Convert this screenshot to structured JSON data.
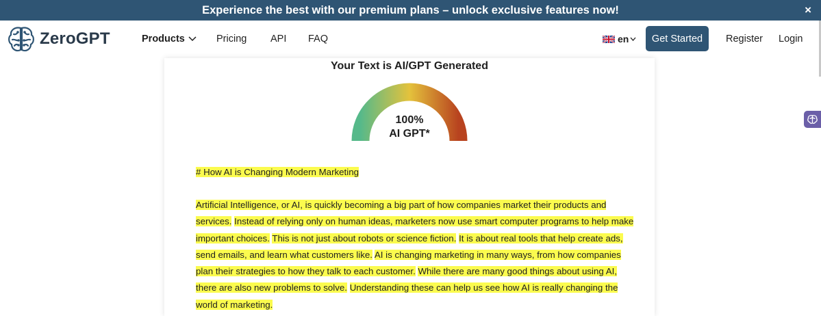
{
  "promo": {
    "text": "Experience the best with our premium plans – unlock exclusive features now!",
    "close": "×"
  },
  "nav": {
    "logo": "ZeroGPT",
    "products": "Products",
    "pricing": "Pricing",
    "api": "API",
    "faq": "FAQ",
    "language": "en",
    "get_started": "Get Started",
    "register": "Register",
    "login": "Login"
  },
  "result": {
    "title": "Your Text is AI/GPT Generated",
    "percent": "100%",
    "label": "AI GPT*",
    "gauge_level": 1.0
  },
  "analysis": {
    "heading": "# How AI is Changing Modern Marketing",
    "sentences": [
      "Artificial Intelligence, or AI, is quickly becoming a big part of how companies market their products and services.",
      "Instead of relying only on human ideas, marketers now use smart computer programs to help make important choices.",
      "This is not just about robots or science fiction.",
      "It is about real tools that help create ads, send emails, and learn what customers like.",
      "AI is changing marketing in many ways, from how companies plan their strategies to how they talk to each customer.",
      "While there are many good things about using AI, there are also new problems to solve.",
      "Understanding these can help us see how AI is really changing the world of marketing."
    ]
  },
  "colors": {
    "brand": "#2f5574",
    "highlight": "#fbfb4e",
    "gauge_start": "#56b98a",
    "gauge_mid": "#e4c23c",
    "gauge_end": "#b8431f"
  },
  "icons": [
    "brain-logo-icon",
    "chevron-down-icon",
    "uk-flag-icon",
    "close-icon",
    "brain-widget-icon"
  ]
}
